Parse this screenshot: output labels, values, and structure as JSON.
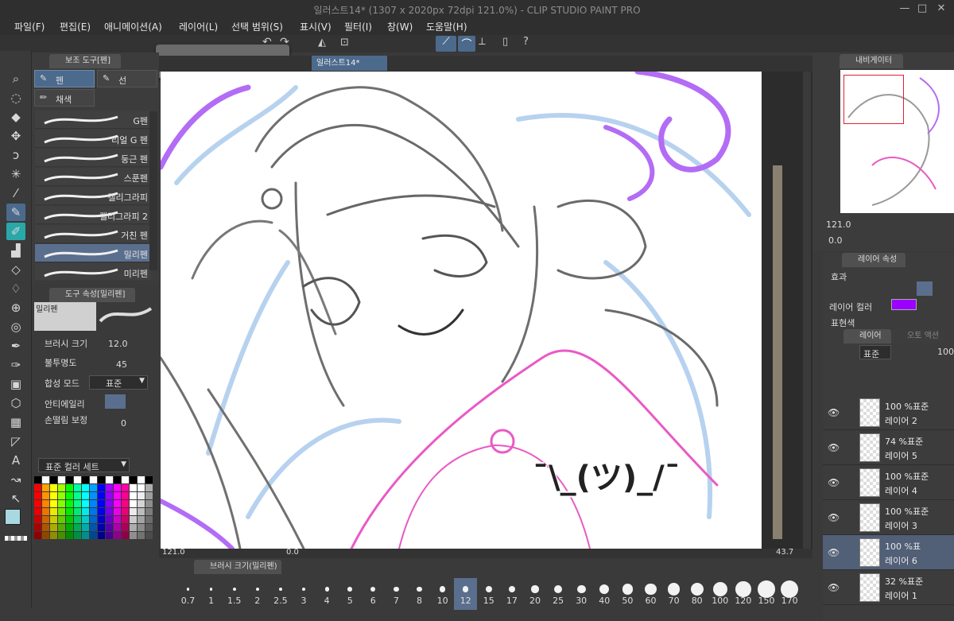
{
  "window": {
    "title": "일러스트14* (1307 x 2020px 72dpi 121.0%)  - CLIP STUDIO PAINT PRO",
    "minimize": "—",
    "maximize": "□",
    "close": "✕"
  },
  "menu": [
    "파일(F)",
    "편집(E)",
    "애니메이션(A)",
    "레이어(L)",
    "선택 범위(S)",
    "표시(V)",
    "필터(I)",
    "창(W)",
    "도움말(H)"
  ],
  "sub_tool_panel": {
    "tab": "보조 도구[펜]",
    "groups": [
      "펜",
      "선",
      "채색"
    ],
    "brushes": [
      "G펜",
      "리얼 G 펜",
      "둥근 펜",
      "스푼펜",
      "캘리그라피",
      "캘리그라피 2",
      "거친 펜",
      "밀리펜",
      "미리펜"
    ],
    "selected_brush": "밀리펜"
  },
  "tool_property": {
    "tab": "도구 속성[밀리펜]",
    "preview_label": "밀리펜",
    "brush_size_label": "브러시 크기",
    "brush_size_value": "12.0",
    "opacity_label": "불투명도",
    "opacity_value": "45",
    "blend_label": "합성 모드",
    "blend_value": "표준",
    "aa_label": "안티에일리",
    "stabilize_label": "손떨림 보정",
    "stabilize_value": "0"
  },
  "color_set": {
    "tab": "표준 컬러 세트"
  },
  "colors": {
    "main": "#a9d8e0",
    "sub": "#111111",
    "accent": "#9b00ff",
    "highlight": "#4d6b8e"
  },
  "document": {
    "tab": "일러스트14*",
    "zoom": "121.0",
    "angle": "0.0",
    "scroll_val": "43.7"
  },
  "canvas_text": "¯\\_(ツ)_/¯",
  "brush_size_panel": {
    "tab": "브러시 크기(밀리펜)",
    "sizes": [
      "0.7",
      "1",
      "1.5",
      "2",
      "2.5",
      "3",
      "4",
      "5",
      "6",
      "7",
      "8",
      "10",
      "12",
      "15",
      "17",
      "20",
      "25",
      "30",
      "40",
      "50",
      "60",
      "70",
      "80",
      "100",
      "120",
      "150",
      "170"
    ],
    "selected": "12"
  },
  "navigator": {
    "tab": "내비게이터",
    "zoom": "121.0",
    "angle": "0.0"
  },
  "layer_property": {
    "tab": "레이어 속성",
    "effect_label": "효과",
    "layer_color_label": "레이어 컬러",
    "expression_label": "표현색"
  },
  "layers_panel": {
    "tab": "레이어",
    "tab2": "오토 액션",
    "blend": "표준",
    "opacity": "100",
    "layers": [
      {
        "blend": "100 %표준",
        "name": "레이어 2"
      },
      {
        "blend": "74 %표준",
        "name": "레이어 5"
      },
      {
        "blend": "100 %표준",
        "name": "레이어 4"
      },
      {
        "blend": "100 %표준",
        "name": "레이어 3"
      },
      {
        "blend": "100 %표",
        "name": "레이어 6"
      },
      {
        "blend": "32 %표준",
        "name": "레이어 1"
      }
    ]
  }
}
